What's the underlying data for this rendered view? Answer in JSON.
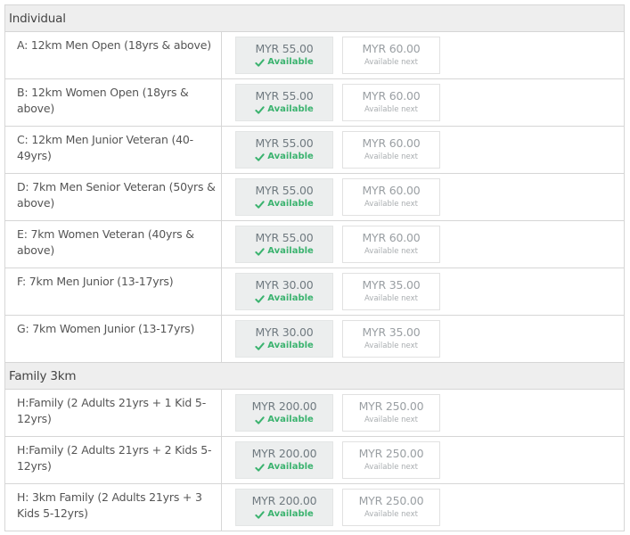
{
  "sections": [
    {
      "title": "Individual",
      "rows": [
        {
          "label": "A: 12km Men Open (18yrs & above)",
          "current_price": "MYR 55.00",
          "current_status": "Available",
          "next_price": "MYR 60.00",
          "next_status": "Available next"
        },
        {
          "label": "B: 12km Women Open (18yrs & above)",
          "current_price": "MYR 55.00",
          "current_status": "Available",
          "next_price": "MYR 60.00",
          "next_status": "Available next"
        },
        {
          "label": "C: 12km Men Junior Veteran (40-49yrs)",
          "current_price": "MYR 55.00",
          "current_status": "Available",
          "next_price": "MYR 60.00",
          "next_status": "Available next"
        },
        {
          "label": "D: 7km Men Senior Veteran (50yrs & above)",
          "current_price": "MYR 55.00",
          "current_status": "Available",
          "next_price": "MYR 60.00",
          "next_status": "Available next"
        },
        {
          "label": "E: 7km Women Veteran (40yrs & above)",
          "current_price": "MYR 55.00",
          "current_status": "Available",
          "next_price": "MYR 60.00",
          "next_status": "Available next"
        },
        {
          "label": "F: 7km Men Junior (13-17yrs)",
          "current_price": "MYR 30.00",
          "current_status": "Available",
          "next_price": "MYR 35.00",
          "next_status": "Available next"
        },
        {
          "label": "G: 7km Women Junior (13-17yrs)",
          "current_price": "MYR 30.00",
          "current_status": "Available",
          "next_price": "MYR 35.00",
          "next_status": "Available next"
        }
      ]
    },
    {
      "title": "Family 3km",
      "rows": [
        {
          "label": "H:Family (2 Adults 21yrs + 1 Kid 5-12yrs)",
          "current_price": "MYR 200.00",
          "current_status": "Available",
          "next_price": "MYR 250.00",
          "next_status": "Available next"
        },
        {
          "label": "H:Family (2 Adults 21yrs + 2 Kids 5-12yrs)",
          "current_price": "MYR 200.00",
          "current_status": "Available",
          "next_price": "MYR 250.00",
          "next_status": "Available next"
        },
        {
          "label": "H: 3km Family (2 Adults 21yrs + 3 Kids 5-12yrs)",
          "current_price": "MYR 200.00",
          "current_status": "Available",
          "next_price": "MYR 250.00",
          "next_status": "Available next"
        }
      ]
    }
  ],
  "icons": {
    "status_icon": "check-icon"
  },
  "colors": {
    "available": "#3bb36f",
    "header_bg": "#eeeeee",
    "border": "#d6d6d6"
  }
}
